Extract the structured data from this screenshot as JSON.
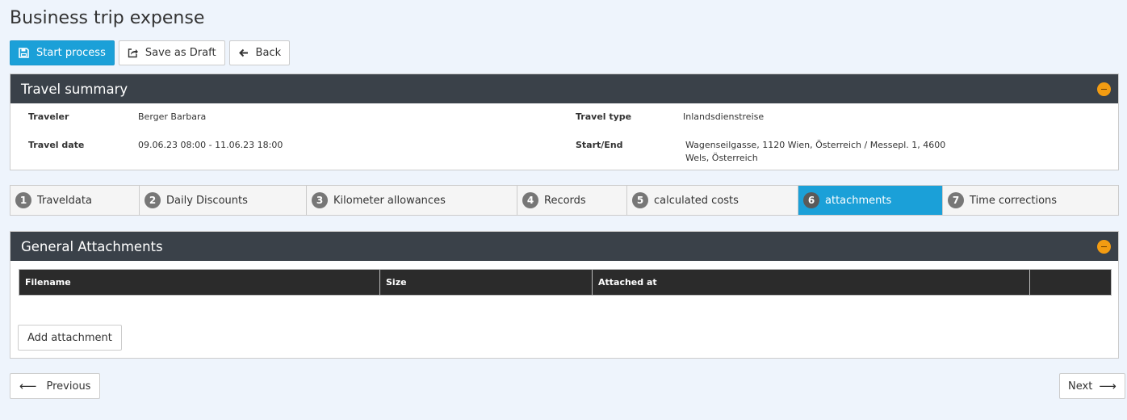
{
  "page": {
    "title": "Business trip expense"
  },
  "toolbar": {
    "start_label": "Start process",
    "draft_label": "Save as Draft",
    "back_label": "Back"
  },
  "summary": {
    "title": "Travel summary",
    "traveler_label": "Traveler",
    "traveler_value": "Berger Barbara",
    "date_label": "Travel date",
    "date_value": "09.06.23 08:00 - 11.06.23 18:00",
    "type_label": "Travel type",
    "type_value": "Inlandsdienstreise",
    "startend_label": "Start/End",
    "startend_line1": "Wagenseilgasse, 1120 Wien, Österreich / Messepl. 1, 4600",
    "startend_line2": "Wels, Österreich"
  },
  "tabs": [
    {
      "num": "1",
      "label": "Traveldata"
    },
    {
      "num": "2",
      "label": "Daily Discounts"
    },
    {
      "num": "3",
      "label": "Kilometer allowances"
    },
    {
      "num": "4",
      "label": "Records"
    },
    {
      "num": "5",
      "label": "calculated costs"
    },
    {
      "num": "6",
      "label": "attachments",
      "active": true
    },
    {
      "num": "7",
      "label": "Time corrections"
    }
  ],
  "attachments": {
    "title": "General Attachments",
    "columns": [
      "Filename",
      "Size",
      "Attached at",
      ""
    ],
    "add_label": "Add attachment"
  },
  "nav": {
    "prev_label": "Previous",
    "next_label": "Next"
  },
  "colors": {
    "primary": "#1ba0d8",
    "panel_header": "#3a4149",
    "collapse": "#f39c12",
    "background": "#eef4fc"
  }
}
